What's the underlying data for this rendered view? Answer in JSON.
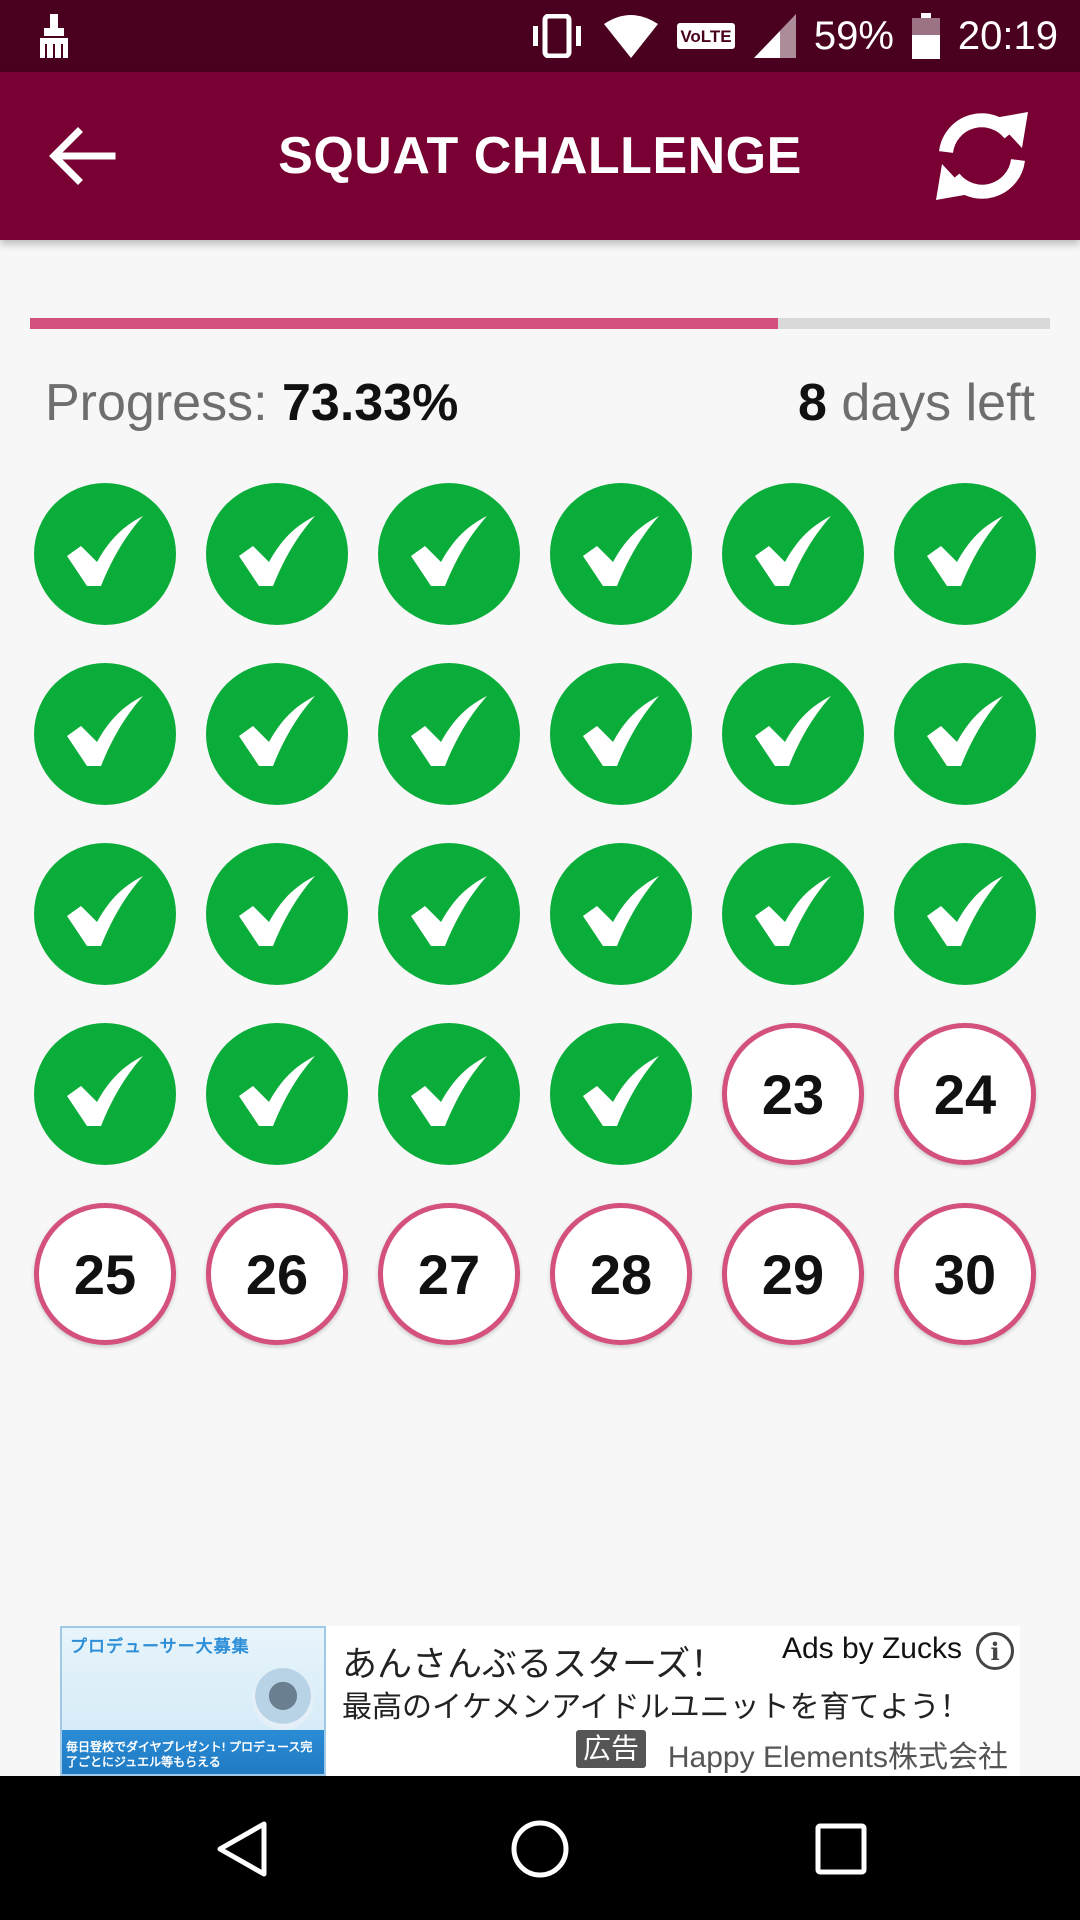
{
  "status_bar": {
    "battery": "59%",
    "time": "20:19",
    "volte": "VoLTE"
  },
  "app_bar": {
    "title": "SQUAT CHALLENGE"
  },
  "progress": {
    "label": "Progress:",
    "value_text": "73.33%",
    "fraction": 0.7333,
    "days_left_count": "8",
    "days_left_suffix": "days left"
  },
  "days": {
    "completed": 22,
    "remaining": [
      "23",
      "24",
      "25",
      "26",
      "27",
      "28",
      "29",
      "30"
    ]
  },
  "ad": {
    "image_top_text": "プロデューサー大募集",
    "image_bottom_text": "毎日登校でダイヤプレゼント! プロデュース完了ごとにジュエル等もらえる",
    "title": "あんさんぶるスターズ！",
    "subtitle": "最高のイケメンアイドルユニットを育てよう！",
    "ads_by": "Ads by Zucks",
    "info": "i",
    "tag": "広告",
    "advertiser": "Happy Elements株式会社"
  },
  "colors": {
    "status_bar": "#4a001f",
    "app_bar": "#780032",
    "accent_pink": "#d4507e",
    "done_green": "#0bad3a"
  }
}
